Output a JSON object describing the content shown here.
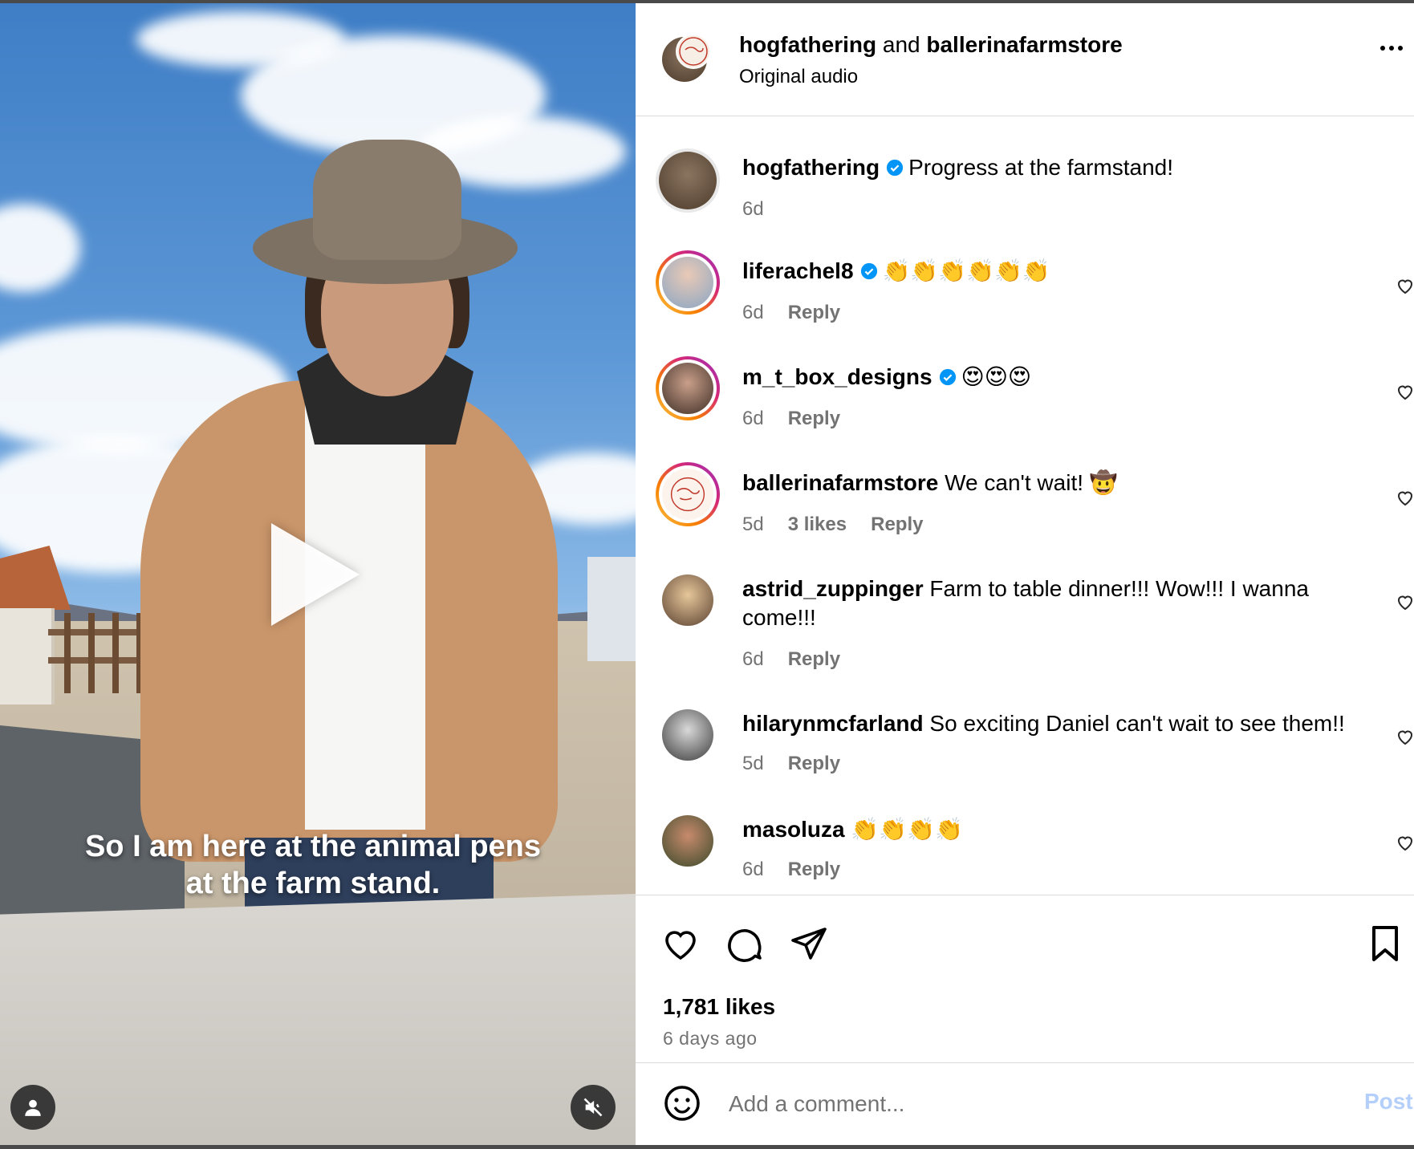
{
  "video": {
    "caption": "So I am here at the animal pens at the farm stand."
  },
  "header": {
    "user1": "hogfathering",
    "joiner": "and",
    "user2": "ballerinafarmstore",
    "audio": "Original audio"
  },
  "post": {
    "username": "hogfathering",
    "caption": "Progress at the farmstand!",
    "time": "6d"
  },
  "comments": [
    {
      "username": "liferachel8",
      "text": "👏👏👏👏👏👏",
      "time": "6d",
      "likes": "",
      "reply": "Reply",
      "verified": true
    },
    {
      "username": "m_t_box_designs",
      "text": "😍😍😍",
      "time": "6d",
      "likes": "",
      "reply": "Reply",
      "verified": true
    },
    {
      "username": "ballerinafarmstore",
      "text": "We can't wait! 🤠",
      "time": "5d",
      "likes": "3 likes",
      "reply": "Reply",
      "verified": false
    },
    {
      "username": "astrid_zuppinger",
      "text": "Farm to table dinner!!! Wow!!! I wanna come!!!",
      "time": "6d",
      "likes": "",
      "reply": "Reply",
      "verified": false
    },
    {
      "username": "hilarynmcfarland",
      "text": "So exciting Daniel can't wait to see them!!",
      "time": "5d",
      "likes": "",
      "reply": "Reply",
      "verified": false
    },
    {
      "username": "masoluza",
      "text": "👏👏👏👏",
      "time": "6d",
      "likes": "",
      "reply": "Reply",
      "verified": false
    }
  ],
  "footer": {
    "likes": "1,781 likes",
    "ago": "6 days ago",
    "comment_placeholder": "Add a comment...",
    "post_label": "Post"
  },
  "colors": {
    "verified": "#0095f6",
    "post_disabled": "#b3cffa",
    "meta_gray": "#737373"
  },
  "icons": [
    "more-options-icon",
    "heart-icon",
    "comment-icon",
    "share-icon",
    "bookmark-icon",
    "emoji-icon",
    "play-icon",
    "user-tag-icon",
    "muted-icon",
    "verified-badge-icon"
  ]
}
